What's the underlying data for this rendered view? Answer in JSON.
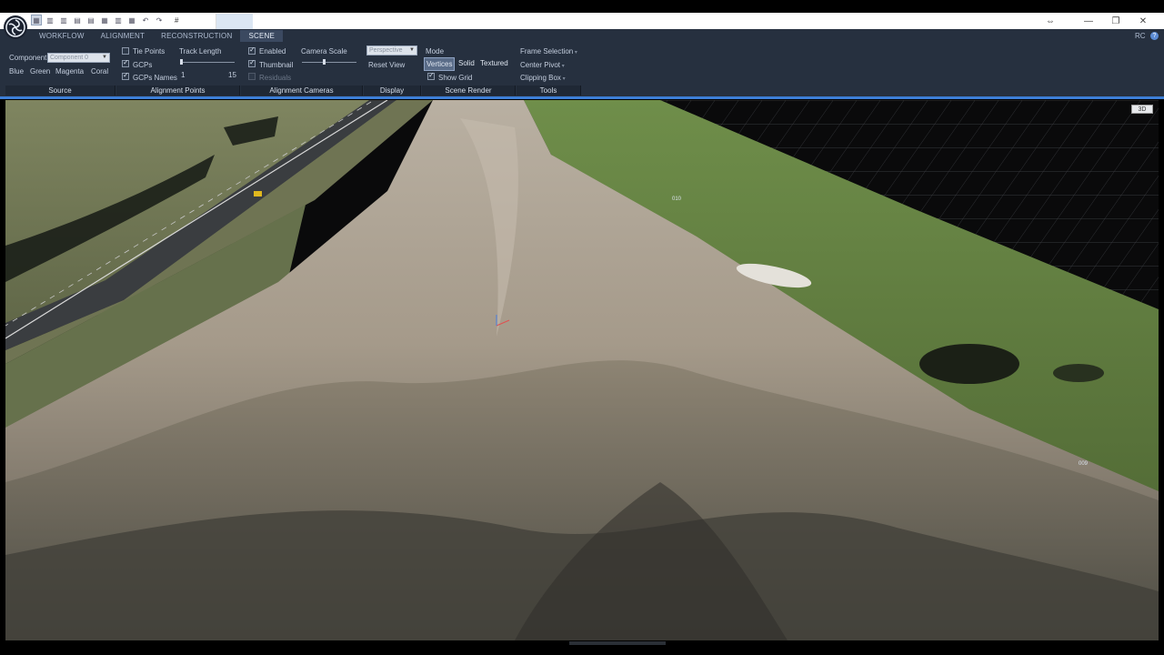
{
  "window": {
    "doc_tab_label": "#",
    "controls": {
      "swap_icon": "⇔",
      "minimize": "—",
      "restore": "❐",
      "close": "✕"
    }
  },
  "ribbon": {
    "tabs": [
      {
        "label": "WORKFLOW",
        "active": false
      },
      {
        "label": "ALIGNMENT",
        "active": false
      },
      {
        "label": "RECONSTRUCTION",
        "active": false
      },
      {
        "label": "SCENE",
        "active": true
      }
    ],
    "rc_label": "RC",
    "help_label": "?",
    "source": {
      "component_label": "Component",
      "component_value": "Component 0",
      "colors": [
        "Blue",
        "Green",
        "Magenta",
        "Coral"
      ],
      "footer": "Source"
    },
    "alignment_points": {
      "tie_points": "Tie Points",
      "gcps": "GCPs",
      "gcps_names": "GCPs Names",
      "track_length_label": "Track Length",
      "track_min": "1",
      "track_max": "15",
      "footer": "Alignment Points"
    },
    "alignment_cameras": {
      "enabled": "Enabled",
      "thumbnail": "Thumbnail",
      "residuals": "Residuals",
      "camera_scale_label": "Camera Scale",
      "footer": "Alignment Cameras"
    },
    "display": {
      "projection_value": "Perspective",
      "reset_view": "Reset View",
      "footer": "Display"
    },
    "scene_render": {
      "mode_label": "Mode",
      "modes": [
        {
          "label": "Vertices",
          "active": true
        },
        {
          "label": "Solid",
          "active": false
        },
        {
          "label": "Textured",
          "active": false
        }
      ],
      "show_grid": "Show Grid",
      "footer": "Scene Render"
    },
    "tools": {
      "frame_selection": "Frame Selection",
      "center_pivot": "Center Pivot",
      "clipping_box": "Clipping Box",
      "footer": "Tools"
    }
  },
  "viewport": {
    "badge": "3D",
    "gcp_labels": [
      "010",
      "009"
    ]
  },
  "colors": {
    "ribbon_bg": "#26303f",
    "accent": "#3d7fd8",
    "grass": "#5f7e3c",
    "gravel": "#a29888"
  }
}
